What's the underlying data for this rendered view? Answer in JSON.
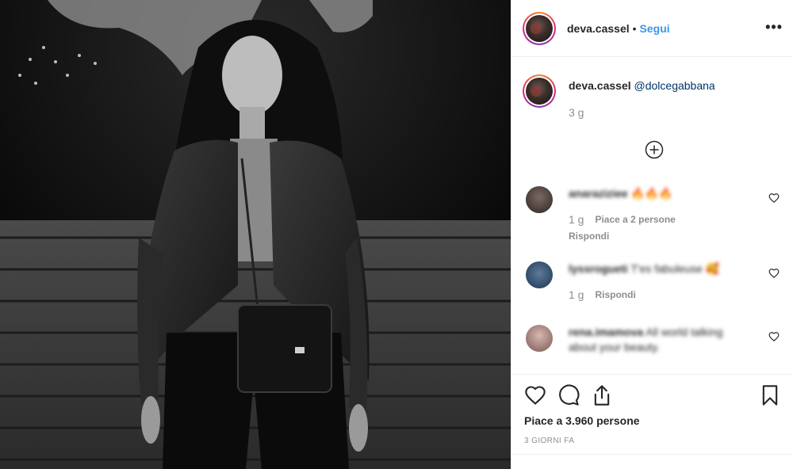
{
  "header": {
    "username": "deva.cassel",
    "separator": "•",
    "follow_label": "Segui",
    "more_icon": "more-horizontal-icon",
    "more_label": "•••"
  },
  "caption": {
    "username": "deva.cassel",
    "mention": "@dolcegabbana",
    "time": "3 g"
  },
  "load_more_icon": "plus-circle-icon",
  "comments": [
    {
      "username": "anaraziziee",
      "text": "🔥🔥🔥",
      "time": "1 g",
      "likes": "Piace a 2 persone",
      "reply": "Rispondi"
    },
    {
      "username": "lyssrogueti",
      "text": "T'es fabuleuse 🥰",
      "time": "1 g",
      "reply": "Rispondi"
    },
    {
      "username": "rena.imamova",
      "text": "All world talking about your beauty."
    }
  ],
  "actions": {
    "like_icon": "heart-icon",
    "comment_icon": "comment-icon",
    "share_icon": "share-icon",
    "save_icon": "bookmark-icon"
  },
  "likes_text": "Piace a 3.960 persone",
  "date_text": "3 GIORNI FA",
  "colors": {
    "link_blue": "#3897f0",
    "mention_blue": "#003569",
    "secondary_text": "#8e8e8e",
    "border": "#efefef"
  }
}
